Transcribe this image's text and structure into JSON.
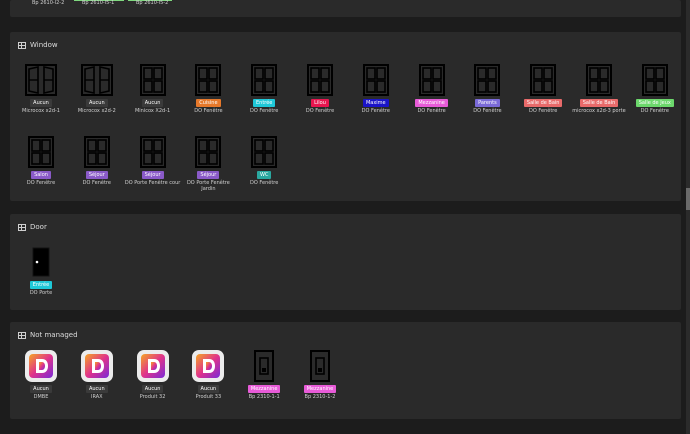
{
  "top_section": {
    "captions": [
      "Bp 2610-l2-2",
      "Bp 2610-l5-1",
      "Bp 2610-l5-2"
    ]
  },
  "sections": {
    "window": {
      "title": "Window",
      "items": [
        {
          "badge": "Aucun",
          "color": "#3a3a3a",
          "caption": "Microcox x2d-1",
          "icon": "casement-window-icon"
        },
        {
          "badge": "Aucun",
          "color": "#3a3a3a",
          "caption": "Microcox x2d-2",
          "icon": "casement-window-icon"
        },
        {
          "badge": "Aucun",
          "color": "#3a3a3a",
          "caption": "Minicox X2d-1",
          "icon": "window-icon"
        },
        {
          "badge": "Cuisine",
          "color": "#e6782a",
          "caption": "DO Fenêtre",
          "icon": "window-icon"
        },
        {
          "badge": "Entrée",
          "color": "#1ec8d8",
          "caption": "DO Fenêtre",
          "icon": "window-icon"
        },
        {
          "badge": "Lilou",
          "color": "#e8154f",
          "caption": "DO Fenêtre",
          "icon": "window-icon"
        },
        {
          "badge": "Maxime",
          "color": "#1a14c8",
          "caption": "DO Fenêtre",
          "icon": "window-icon"
        },
        {
          "badge": "Mezzanine",
          "color": "#e85bd8",
          "caption": "DO Fenêtre",
          "icon": "window-icon"
        },
        {
          "badge": "Parents",
          "color": "#7a6ad8",
          "caption": "DO Fenêtre",
          "icon": "window-icon"
        },
        {
          "badge": "Salle de Bain",
          "color": "#e86a6a",
          "caption": "DO Fenêtre",
          "icon": "window-icon"
        },
        {
          "badge": "Salle de Bain",
          "color": "#e86a6a",
          "caption": "microcox x2d-3 porte",
          "icon": "window-icon"
        },
        {
          "badge": "Salle de Jeux",
          "color": "#6cd86c",
          "caption": "DO Fenêtre",
          "icon": "window-icon"
        },
        {
          "badge": "Salon",
          "color": "#8a5ac8",
          "caption": "DO Fenêtre",
          "icon": "window-icon"
        },
        {
          "badge": "Séjour",
          "color": "#8a5ac8",
          "caption": "DO Fenêtre",
          "icon": "window-icon"
        },
        {
          "badge": "Séjour",
          "color": "#8a5ac8",
          "caption": "DO Porte Fenêtre cour",
          "icon": "window-icon"
        },
        {
          "badge": "Séjour",
          "color": "#8a5ac8",
          "caption": "DO Porte Fenêtre Jardin",
          "icon": "window-icon"
        },
        {
          "badge": "WC",
          "color": "#2aa8a0",
          "caption": "DO Fenêtre",
          "icon": "window-icon"
        }
      ]
    },
    "door": {
      "title": "Door",
      "items": [
        {
          "badge": "Entrée",
          "color": "#1ec8d8",
          "caption": "DO Porte",
          "icon": "door-icon"
        }
      ]
    },
    "not_managed": {
      "title": "Not managed",
      "items": [
        {
          "badge": "Aucun",
          "color": "#3a3a3a",
          "caption": "DMBE",
          "icon": "app-logo-icon"
        },
        {
          "badge": "Aucun",
          "color": "#3a3a3a",
          "caption": "IRAX",
          "icon": "app-logo-icon"
        },
        {
          "badge": "Aucun",
          "color": "#3a3a3a",
          "caption": "Produit 32",
          "icon": "app-logo-icon"
        },
        {
          "badge": "Aucun",
          "color": "#3a3a3a",
          "caption": "Produit 33",
          "icon": "app-logo-icon"
        },
        {
          "badge": "Mezzanine",
          "color": "#e85bd8",
          "caption": "Bp 2310-1-1",
          "icon": "wall-switch-icon"
        },
        {
          "badge": "Mezzanine",
          "color": "#e85bd8",
          "caption": "Bp 2310-1-2",
          "icon": "wall-switch-icon"
        }
      ]
    }
  }
}
